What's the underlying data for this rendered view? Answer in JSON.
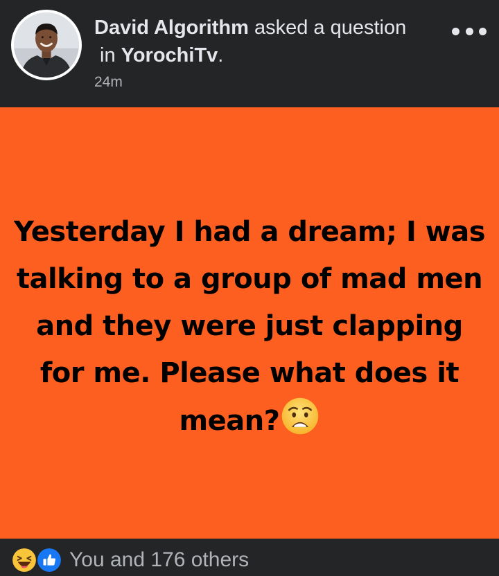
{
  "post": {
    "author_name": "David Algorithm",
    "action_text": " asked a question",
    "in_prefix": "in ",
    "group_name": "YorochiTv",
    "group_suffix": ".",
    "timestamp": "24m",
    "body_text": "Yesterday I had a dream; I was talking to a group of mad men and they were just clapping for me. Please what does it mean?",
    "body_emoji": "worried-face-emoji",
    "background_color": "#fd5f21"
  },
  "footer": {
    "reactions": [
      "haha-reaction-icon",
      "like-reaction-icon"
    ],
    "summary_text": "You and 176 others"
  },
  "colors": {
    "bar_background": "#242526",
    "primary_text": "#e4e6eb",
    "secondary_text": "#b0b3b8",
    "post_background": "#fd5f21",
    "like_blue": "#1877f2"
  }
}
